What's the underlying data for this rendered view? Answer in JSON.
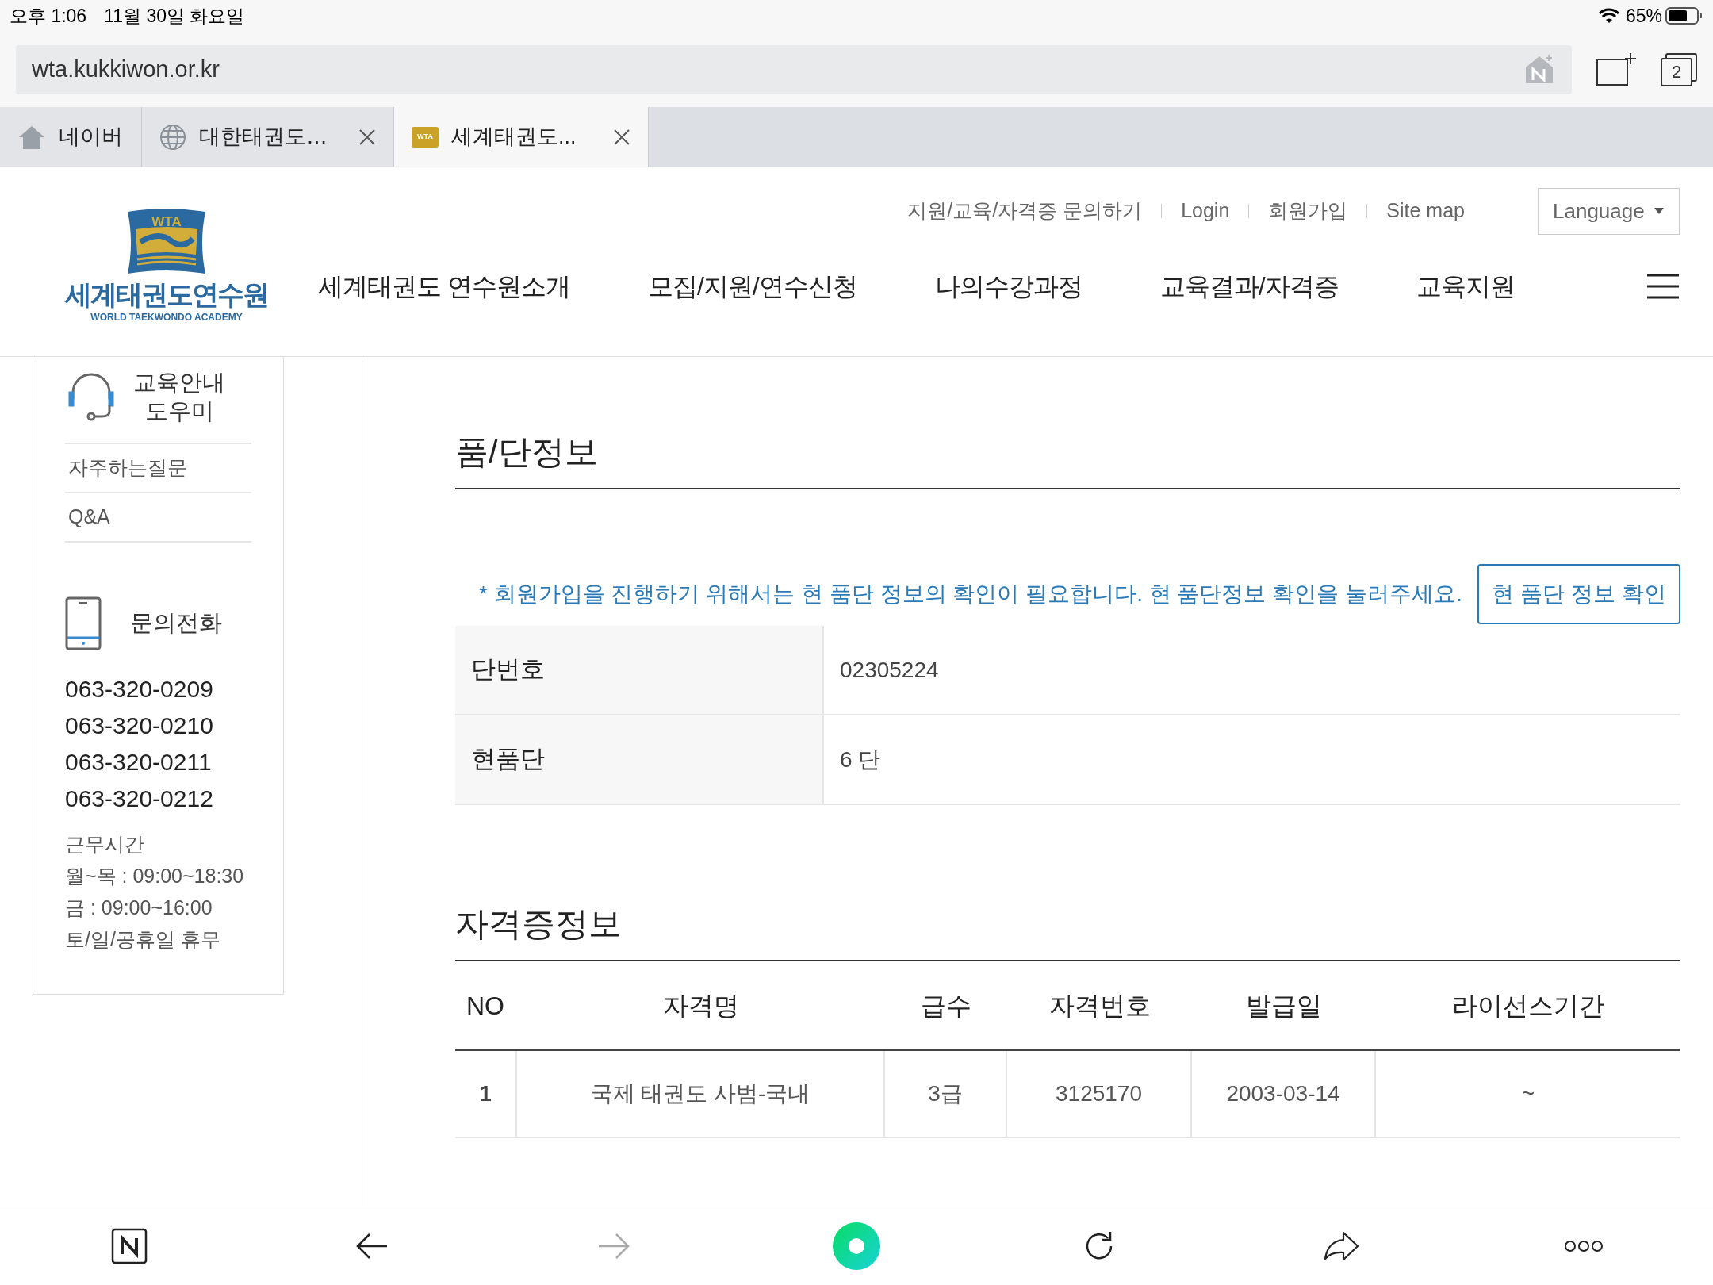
{
  "status_bar": {
    "time": "오후 1:06",
    "date": "11월 30일 화요일",
    "battery": "65%"
  },
  "browser": {
    "url": "wta.kukkiwon.or.kr",
    "tab_count": "2",
    "tabs": [
      {
        "kind": "home",
        "label": "네이버",
        "selected": false,
        "closable": false
      },
      {
        "kind": "globe",
        "label": "대한태권도…",
        "selected": false,
        "closable": true
      },
      {
        "kind": "favicon",
        "favicon_text": "WTA",
        "label": "세계태권도...",
        "selected": true,
        "closable": true
      }
    ]
  },
  "header": {
    "logo": {
      "badge": "WTA",
      "name": "세계태권도연수원",
      "subtitle": "WORLD TAEKWONDO ACADEMY"
    },
    "utility_links": [
      "지원/교육/자격증 문의하기",
      "Login",
      "회원가입",
      "Site map"
    ],
    "language": "Language",
    "nav": [
      "세계태권도 연수원소개",
      "모집/지원/연수신청",
      "나의수강과정",
      "교육결과/자격증",
      "교육지원"
    ]
  },
  "sidebar": {
    "helper_title": "교육안내\n도우미",
    "links": [
      "자주하는질문",
      "Q&A"
    ],
    "phone_title": "문의전화",
    "phones": [
      "063-320-0209",
      "063-320-0210",
      "063-320-0211",
      "063-320-0212"
    ],
    "hours": [
      "근무시간",
      "월~목 : 09:00~18:30",
      "금 : 09:00~16:00",
      "토/일/공휴일 휴무"
    ]
  },
  "rank_info": {
    "title": "품/단정보",
    "notice": "* 회원가입을 진행하기 위해서는 현 품단 정보의 확인이 필요합니다. 현 품단정보 확인을 눌러주세요.",
    "button": "현 품단 정보 확인",
    "rows": [
      {
        "label": "단번호",
        "value": "02305224"
      },
      {
        "label": "현품단",
        "value": "6 단"
      }
    ]
  },
  "certificates": {
    "title": "자격증정보",
    "columns": [
      "NO",
      "자격명",
      "급수",
      "자격번호",
      "발급일",
      "라이선스기간"
    ],
    "rows": [
      [
        "1",
        "국제 태권도 사범-국내",
        "3급",
        "3125170",
        "2003-03-14",
        "~"
      ]
    ]
  },
  "toolbar": [
    {
      "kind": "naver"
    },
    {
      "kind": "back",
      "disabled": false
    },
    {
      "kind": "forward",
      "disabled": true
    },
    {
      "kind": "home"
    },
    {
      "kind": "reload"
    },
    {
      "kind": "share"
    },
    {
      "kind": "more"
    }
  ]
}
